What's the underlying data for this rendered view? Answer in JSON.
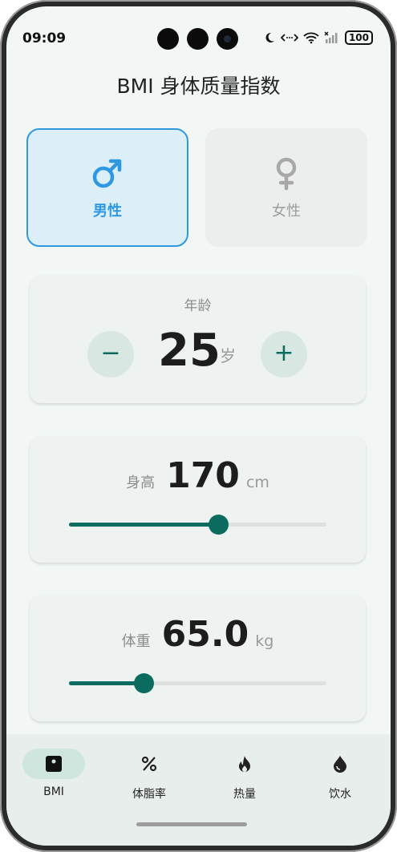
{
  "status": {
    "time": "09:09",
    "battery": "100"
  },
  "header": {
    "title": "BMI 身体质量指数"
  },
  "gender": {
    "male_label": "男性",
    "female_label": "女性",
    "selected": "male"
  },
  "age": {
    "label": "年龄",
    "value": "25",
    "unit": "岁",
    "minus": "−",
    "plus": "+"
  },
  "height": {
    "label": "身高",
    "value": "170",
    "unit": "cm",
    "slider_fraction": 0.58
  },
  "weight": {
    "label": "体重",
    "value": "65.0",
    "unit": "kg",
    "slider_fraction": 0.29
  },
  "tabs": [
    {
      "label": "BMI",
      "icon": "scale-icon",
      "active": true
    },
    {
      "label": "体脂率",
      "icon": "percent-icon",
      "active": false
    },
    {
      "label": "热量",
      "icon": "flame-icon",
      "active": false
    },
    {
      "label": "饮水",
      "icon": "water-drop-icon",
      "active": false
    }
  ],
  "colors": {
    "accent": "#0b6b5e",
    "male_blue": "#2f98e3",
    "background": "#f2f7f5"
  }
}
